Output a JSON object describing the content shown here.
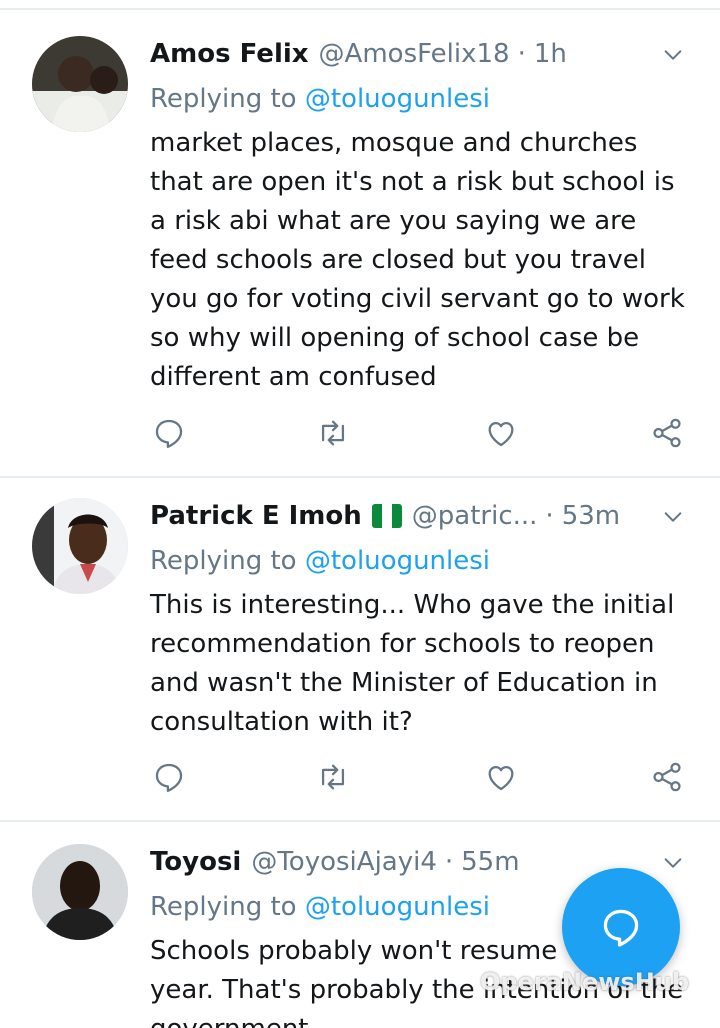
{
  "tweets": [
    {
      "name": "Amos Felix",
      "handle": "@AmosFelix18",
      "time": "1h",
      "replying_prefix": "Replying to",
      "replying_to": "@toluogunlesi",
      "text": "market places, mosque and churches\nthat are open it's not a risk but school is\na risk abi what are you saying we are\nfeed schools are closed but you travel\nyou go for voting civil servant go to work\nso why will opening of school case be\ndifferent am confused"
    },
    {
      "name": "Patrick E Imoh",
      "handle": "@patric...",
      "time": "53m",
      "replying_prefix": "Replying to",
      "replying_to": "@toluogunlesi",
      "text": "This is interesting... Who gave the initial\nrecommendation for schools to reopen\nand wasn't the Minister of Education in\nconsultation with it?"
    },
    {
      "name": "Toyosi",
      "handle": "@ToyosiAjayi4",
      "time": "55m",
      "replying_prefix": "Replying to",
      "replying_to": "@toluogunlesi",
      "text": "Schools probably won't resume\nyear. That's probably the intention of the\ngovernment"
    }
  ],
  "dot": "·",
  "flag_colors": [
    "#0b8a3c",
    "#ffffff",
    "#0b8a3c"
  ],
  "accent_color": "#1da1f2",
  "watermark": "OperaNewsHub",
  "icons": {
    "reply": "reply-icon",
    "retweet": "retweet-icon",
    "like": "like-icon",
    "share": "share-icon",
    "caret": "chevron-down-icon",
    "compose": "compose-icon"
  }
}
